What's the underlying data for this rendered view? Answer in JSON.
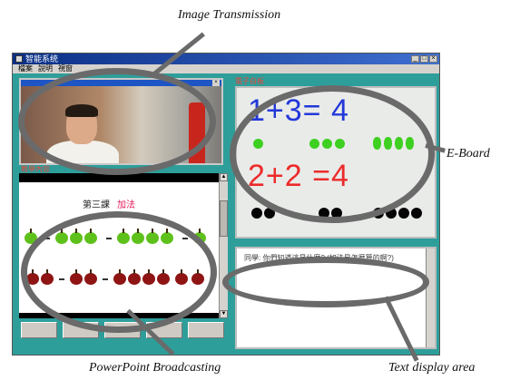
{
  "captions": {
    "image_transmission": "Image Transmission",
    "eboard": "E-Board",
    "ppt": "PowerPoint Broadcasting",
    "text_area": "Text display area"
  },
  "window": {
    "title": "智能系统",
    "menu": [
      "檔案",
      "說明",
      "視窗"
    ],
    "min": "_",
    "max": "□",
    "close": "×"
  },
  "video": {
    "close": "×"
  },
  "panels": {
    "slide_label": "教學內容",
    "eboard_label": "電子白板"
  },
  "slide": {
    "title_black": "第三課",
    "title_red": "加法"
  },
  "eboard": {
    "eq1": "1+3= 4",
    "eq2": "2+2 =4"
  },
  "text_area": {
    "content": "同學: 你們知道這是什麼? (加法是怎麼算的啊?)"
  },
  "scroll": {
    "up": "▲",
    "down": "▼"
  },
  "colors": {
    "window_bg": "#2e9e9a",
    "titlebar": "#0b2f86",
    "overlay": "#6a6a6a",
    "eq1": "#2338d8",
    "eq2": "#ec2b2b",
    "apple_green": "#5ec11b",
    "apple_red": "#8f1414"
  }
}
